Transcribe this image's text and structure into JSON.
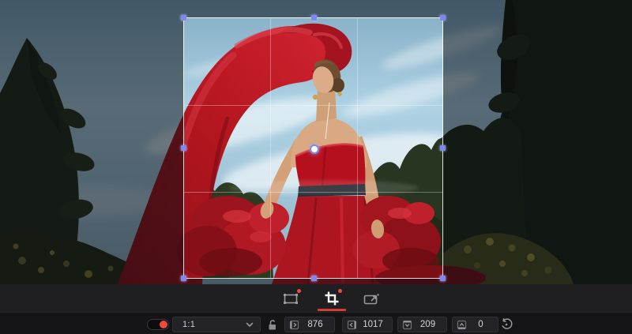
{
  "tabs": [
    {
      "id": "transform",
      "has_badge": true,
      "selected": false
    },
    {
      "id": "crop",
      "has_badge": true,
      "selected": true
    },
    {
      "id": "dynamic-zoom",
      "has_badge": false,
      "selected": false
    }
  ],
  "controls": {
    "tool_enabled": "on",
    "aspect_ratio_value": "1:1",
    "lock_state": "unlocked",
    "fields": [
      {
        "label": "crop-left",
        "value": "876"
      },
      {
        "label": "crop-right",
        "value": "1017"
      },
      {
        "label": "crop-top",
        "value": "209"
      },
      {
        "label": "crop-bottom",
        "value": "0"
      }
    ]
  },
  "colors": {
    "accent_red": "#ee4a3c",
    "handle_blue": "#7e88f0",
    "crop_border": "#ffffff"
  }
}
